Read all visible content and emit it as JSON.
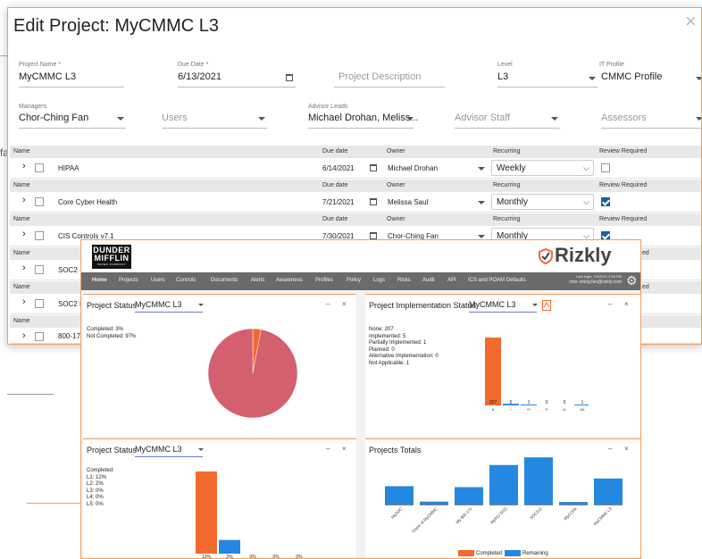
{
  "background": {
    "side_letter": "fa"
  },
  "modal": {
    "title": "Edit Project: MyCMMC L3",
    "close": "×",
    "fields": {
      "project_name": {
        "label": "Project Name *",
        "value": "MyCMMC L3"
      },
      "due_date": {
        "label": "Due Date *",
        "value": "6/13/2021"
      },
      "description": {
        "placeholder": "Project Description"
      },
      "level": {
        "label": "Level",
        "value": "L3"
      },
      "it_profile": {
        "label": "IT Profile",
        "value": "CMMC Profile"
      },
      "managers": {
        "label": "Managers",
        "value": "Chor-Ching Fan"
      },
      "users": {
        "placeholder": "Users"
      },
      "advisor_leads": {
        "label": "Advisor Leads",
        "value": "Michael Drohan, Meliss..."
      },
      "advisor_staff": {
        "placeholder": "Advisor Staff"
      },
      "assessors": {
        "placeholder": "Assessors"
      }
    },
    "table": {
      "headers": {
        "name": "Name",
        "due": "Due date",
        "owner": "Owner",
        "recurring": "Recurring",
        "review": "Review Required"
      },
      "rows": [
        {
          "name": "HIPAA",
          "due": "6/14/2021",
          "owner": "Michael Drohan",
          "recurring": "Weekly",
          "review": false
        },
        {
          "name": "Core Cyber Health",
          "due": "7/21/2021",
          "owner": "Melissa Saul",
          "recurring": "Monthly",
          "review": true
        },
        {
          "name": "CIS Controls v7.1",
          "due": "7/30/2021",
          "owner": "Chor-Ching Fan",
          "recurring": "Monthly",
          "review": true
        },
        {
          "name": "SOC2",
          "review_suffix": "ed"
        },
        {
          "name": "SOC2 P",
          "review_suffix": "ed"
        },
        {
          "name": "800-171"
        }
      ]
    }
  },
  "dashboard": {
    "logo_text": "DUNDER MIFFLIN",
    "logo_sub": "PAPER COMPANY",
    "brand": "Rizkly",
    "last_login": "Last login: 7/4/2021 2:38 PM",
    "user_email": "chor-ching.fan@rizkly.com",
    "nav": [
      "Home",
      "Projects",
      "Users",
      "Controls",
      "Documents",
      "Alerts",
      "Awareness",
      "Profiles",
      "Policy",
      "Logs",
      "Risks",
      "Audit",
      "API",
      "ICS and POAM Defaults"
    ],
    "panel_status": {
      "title": "Project Status",
      "select": "MyCMMC L3",
      "stats": [
        "Completed: 3%",
        "Not Completed: 97%"
      ]
    },
    "panel_impl": {
      "title": "Project Implementation Status",
      "select": "MyCMMC L3",
      "stats": [
        "None: 207",
        "Implemented: 5",
        "Partially Implemented: 1",
        "Planned: 0",
        "Alternative Implementation: 0",
        "Not Applicable: 1"
      ]
    },
    "panel_level": {
      "title": "Project Status",
      "select": "MyCMMC L3",
      "stats": [
        "Completed:",
        "L1: 12%",
        "L2: 2%",
        "L3: 0%",
        "L4: 0%",
        "L5: 0%"
      ]
    },
    "panel_totals": {
      "title": "Projects Totals",
      "legend_completed": "Completed",
      "legend_remaining": "Remaining"
    },
    "controls": {
      "minimize": "–",
      "close": "×"
    }
  },
  "chart_data": [
    {
      "type": "pie",
      "title": "Project Status",
      "labels": [
        "Completed",
        "Not Completed"
      ],
      "values": [
        3,
        97
      ],
      "colors": [
        "#f26a2e",
        "#d45f6f"
      ]
    },
    {
      "type": "bar",
      "title": "Project Implementation Status",
      "categories": [
        "N",
        "I",
        "PI",
        "P",
        "AI",
        "NA"
      ],
      "values": [
        207,
        5,
        1,
        0,
        0,
        1
      ],
      "data_labels": [
        "207",
        "5",
        "1",
        "0",
        "0",
        "1"
      ],
      "ylim": [
        0,
        207
      ]
    },
    {
      "type": "bar",
      "title": "Project Status",
      "categories": [
        "L1",
        "L2",
        "L3",
        "L4",
        "L5"
      ],
      "values": [
        12,
        2,
        0,
        0,
        0
      ],
      "data_labels": [
        "12%",
        "2%",
        "0%",
        "0%",
        "0%"
      ],
      "ylim": [
        0,
        12
      ]
    },
    {
      "type": "bar",
      "title": "Projects Totals",
      "categories": [
        "MySOC",
        "Clone of MyCMMC",
        "My 800-171",
        "MyPCI DSS",
        "SOC2v2",
        "MyCCPA",
        "MyCMMC L3"
      ],
      "series": [
        {
          "name": "Completed",
          "values": [
            0,
            0,
            0,
            0,
            0,
            0,
            0
          ]
        },
        {
          "name": "Remaining",
          "values": [
            100,
            20,
            95,
            210,
            250,
            18,
            140
          ]
        }
      ],
      "ylim": [
        0,
        260
      ],
      "legend": "bottom"
    }
  ]
}
